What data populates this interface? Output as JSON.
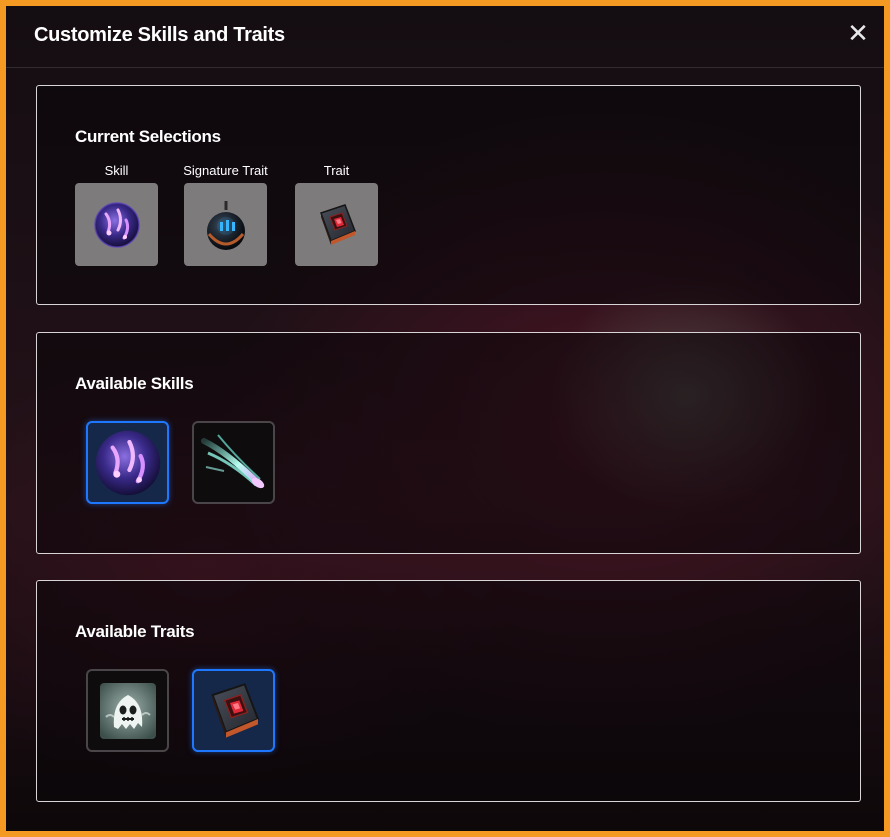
{
  "modal": {
    "title": "Customize Skills and Traits",
    "close_symbol": "✕"
  },
  "current": {
    "heading": "Current Selections",
    "slots": [
      {
        "label": "Skill",
        "icon": "purple-claw-orb-icon"
      },
      {
        "label": "Signature Trait",
        "icon": "dark-bomb-icon"
      },
      {
        "label": "Trait",
        "icon": "red-gem-book-icon"
      }
    ]
  },
  "skills": {
    "heading": "Available Skills",
    "options": [
      {
        "icon": "purple-claw-orb-icon",
        "selected": true
      },
      {
        "icon": "ice-comet-slash-icon",
        "selected": false
      }
    ]
  },
  "traits": {
    "heading": "Available Traits",
    "options": [
      {
        "icon": "ghost-skull-icon",
        "selected": false
      },
      {
        "icon": "red-gem-book-icon",
        "selected": true
      }
    ]
  },
  "colors": {
    "frame": "#f49a22",
    "selection_border": "#1e78ff",
    "slot_background": "#7d7b7c"
  }
}
